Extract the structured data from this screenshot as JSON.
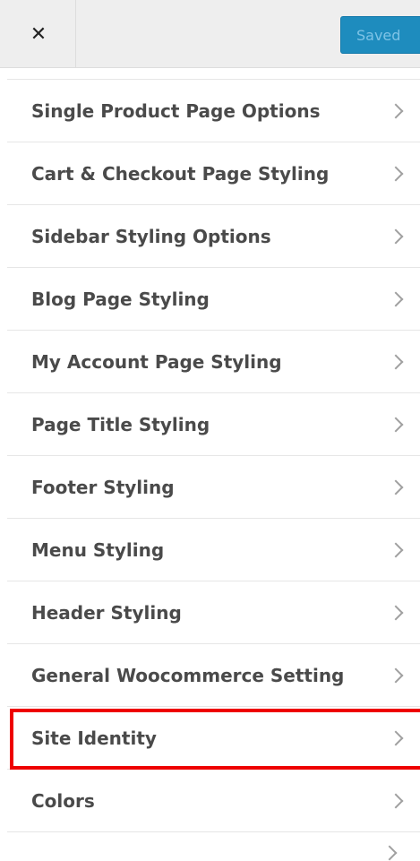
{
  "header": {
    "close_glyph": "✕",
    "saved_label": "Saved"
  },
  "menu": {
    "items": [
      {
        "label": "Single Product Page Options"
      },
      {
        "label": "Cart & Checkout Page Styling"
      },
      {
        "label": "Sidebar Styling Options"
      },
      {
        "label": "Blog Page Styling"
      },
      {
        "label": "My Account Page Styling"
      },
      {
        "label": "Page Title Styling"
      },
      {
        "label": "Footer Styling"
      },
      {
        "label": "Menu Styling"
      },
      {
        "label": "Header Styling"
      },
      {
        "label": "General Woocommerce Setting"
      },
      {
        "label": "Site Identity"
      },
      {
        "label": "Colors"
      }
    ]
  },
  "colors": {
    "accent": "#1e8cbe",
    "highlight": "#ee0000"
  }
}
